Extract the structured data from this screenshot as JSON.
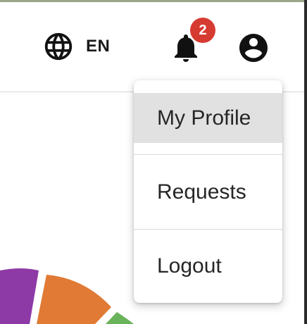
{
  "header": {
    "language": {
      "icon": "globe-icon",
      "code": "EN"
    },
    "notifications": {
      "icon": "bell-icon",
      "count": "2",
      "badge_color": "#d63b32"
    },
    "account": {
      "icon": "account-circle-icon"
    }
  },
  "account_menu": {
    "items": [
      {
        "label": "My Profile",
        "selected": true
      },
      {
        "label": "Requests",
        "selected": false
      },
      {
        "label": "Logout",
        "selected": false
      }
    ]
  },
  "colors": {
    "menu_highlight": "#e1e1e1",
    "chart_purple": "#8e3aa6",
    "chart_orange": "#e07a34",
    "chart_green": "#6bb35a"
  }
}
